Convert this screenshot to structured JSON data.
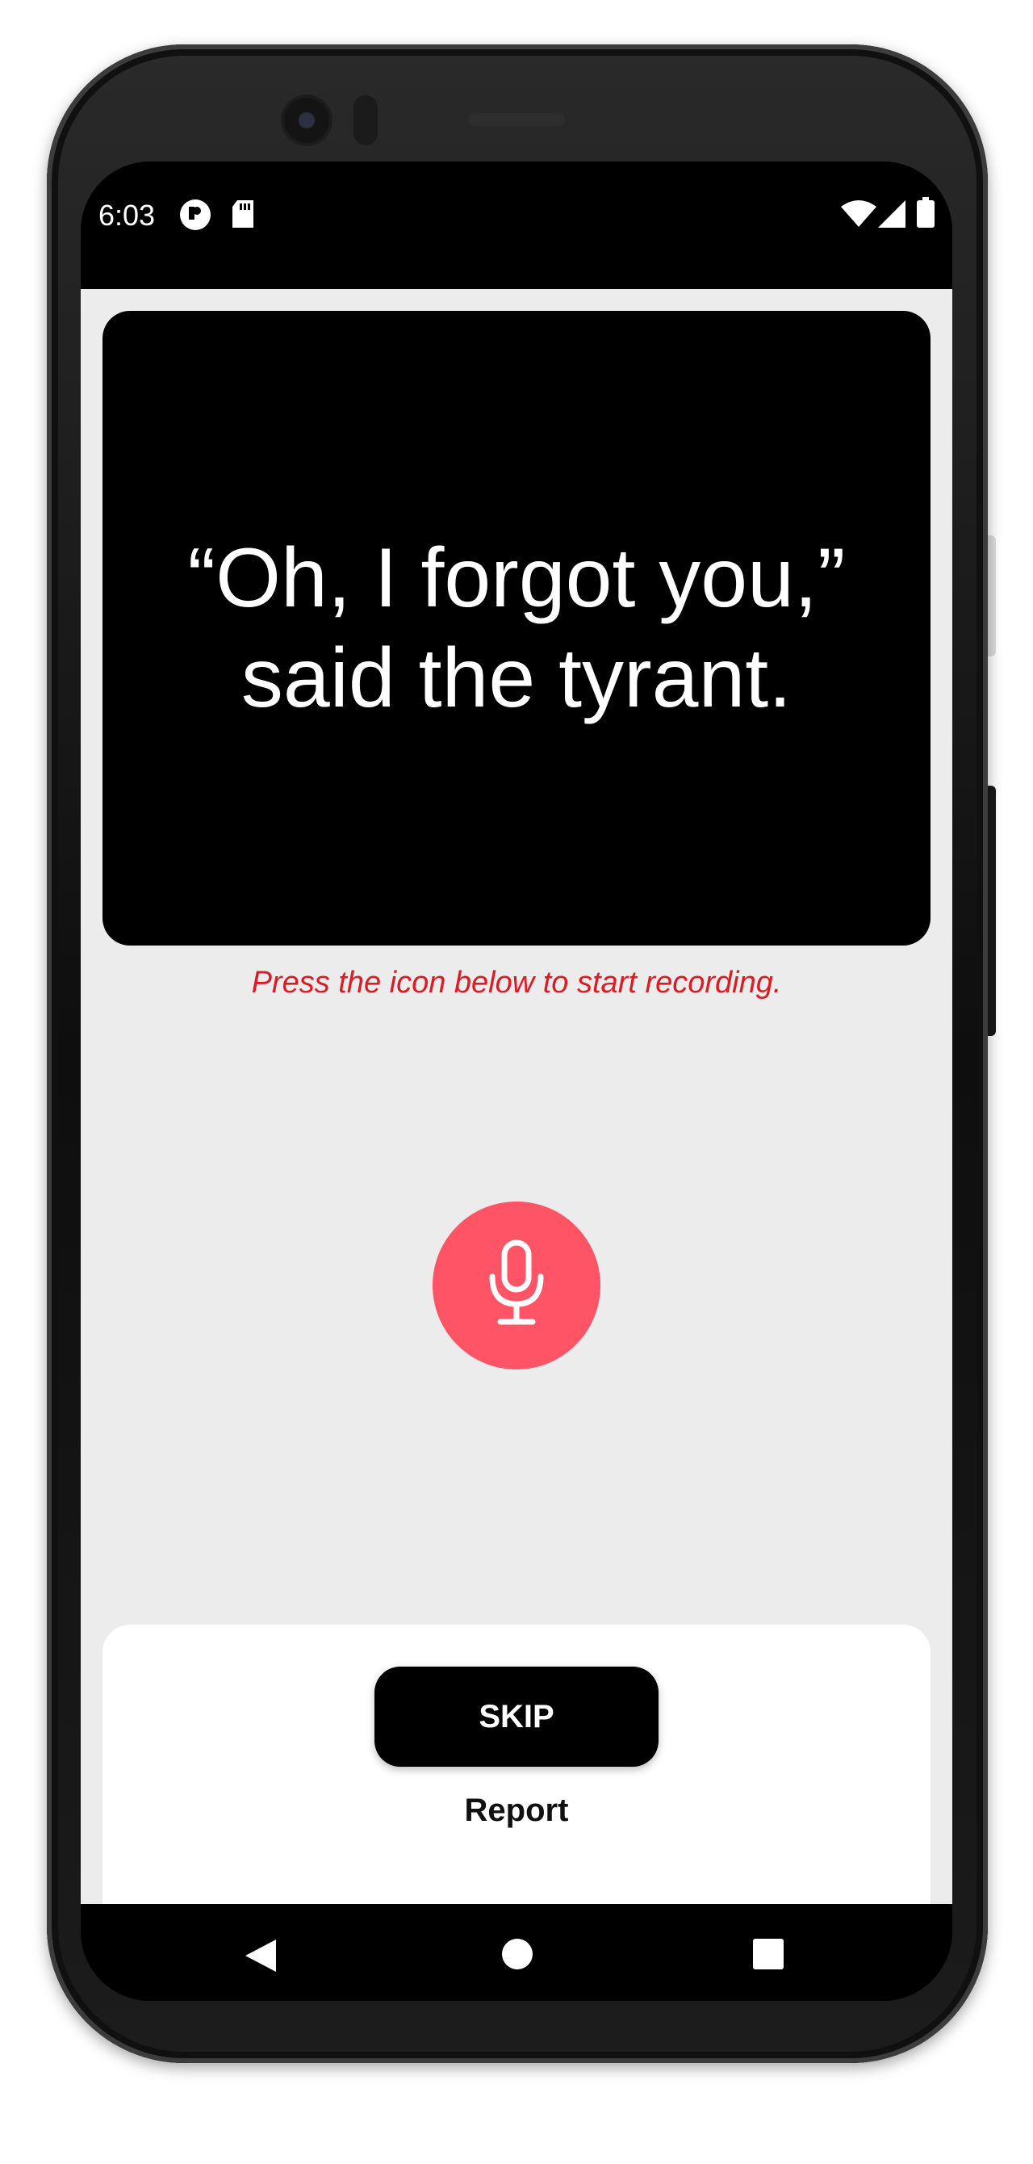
{
  "status_bar": {
    "time": "6:03",
    "left_icons": [
      "notification-app-icon",
      "sd-card-icon"
    ],
    "right_icons": [
      "wifi-icon",
      "cellular-signal-icon",
      "battery-icon"
    ]
  },
  "prompt": {
    "line1": "“Oh, I forgot you,”",
    "line2": "said the tyrant."
  },
  "hint": "Press the icon below to start recording.",
  "mic_button": {
    "icon": "microphone-icon",
    "color": "#ff5465"
  },
  "actions": {
    "skip_label": "SKIP",
    "report_label": "Report"
  },
  "nav_bar": {
    "buttons": [
      "back-icon",
      "home-icon",
      "recents-icon"
    ]
  },
  "colors": {
    "app_background": "#ececec",
    "card": "#000000",
    "hint_text": "#e01a22",
    "mic_accent": "#ff5465"
  }
}
